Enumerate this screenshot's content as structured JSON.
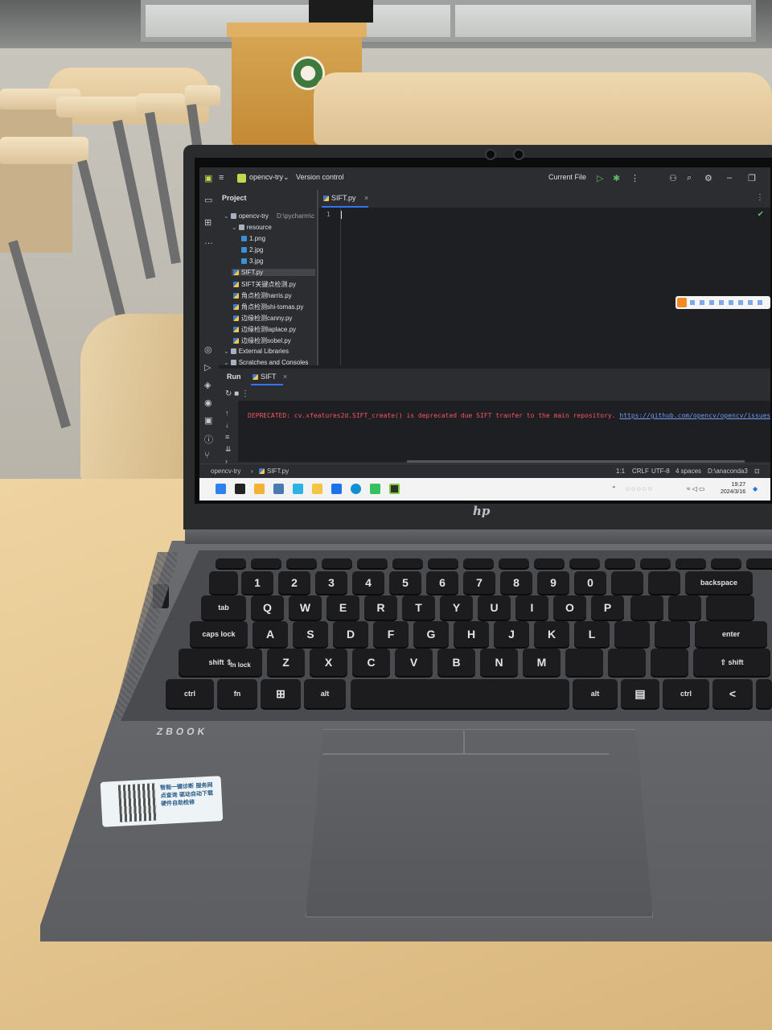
{
  "ide": {
    "project_name": "opencv-try",
    "version_control": "Version control",
    "run_config": "Current File",
    "project_panel_title": "Project",
    "root_path": "D:\\pycharm\\c",
    "tree": [
      {
        "label": "opencv-try",
        "kind": "dir",
        "indent": 0
      },
      {
        "label": "resource",
        "kind": "dir",
        "indent": 1
      },
      {
        "label": "1.png",
        "kind": "img",
        "indent": 2
      },
      {
        "label": "2.jpg",
        "kind": "img",
        "indent": 2
      },
      {
        "label": "3.jpg",
        "kind": "img",
        "indent": 2
      },
      {
        "label": "SIFT.py",
        "kind": "py",
        "indent": 1,
        "selected": true
      },
      {
        "label": "SIFT关键点检测.py",
        "kind": "py",
        "indent": 1
      },
      {
        "label": "角点检测harris.py",
        "kind": "py",
        "indent": 1
      },
      {
        "label": "角点检测shi-tomas.py",
        "kind": "py",
        "indent": 1
      },
      {
        "label": "边缘检测canny.py",
        "kind": "py",
        "indent": 1
      },
      {
        "label": "边缘检测laplace.py",
        "kind": "py",
        "indent": 1
      },
      {
        "label": "边缘检测sobel.py",
        "kind": "py",
        "indent": 1
      },
      {
        "label": "External Libraries",
        "kind": "dir",
        "indent": 0
      },
      {
        "label": "Scratches and Consoles",
        "kind": "dir",
        "indent": 0
      }
    ],
    "editor_tab": "SIFT.py",
    "line_number": "1",
    "run_title": "Run",
    "run_tab": "SIFT",
    "console_error": "DEPRECATED: cv.xfeatures2d.SIFT_create() is deprecated due SIFT tranfer to the main repository.",
    "console_link": "https://github.com/opencv/opencv/issues/16736",
    "status": {
      "breadcrumb_project": "opencv-try",
      "breadcrumb_file": "SIFT.py",
      "position": "1:1",
      "line_sep": "CRLF",
      "encoding": "UTF-8",
      "indent": "4 spaces",
      "interpreter": "D:\\anaconda3"
    }
  },
  "taskbar": {
    "time": "19:27",
    "date": "2024/3/16"
  },
  "laptop": {
    "brand_logo": "hp",
    "model": "ZBOOK",
    "keys_row_num": [
      "1",
      "2",
      "3",
      "4",
      "5",
      "6",
      "7",
      "8",
      "9",
      "0"
    ],
    "keys_row_q": [
      "Q",
      "W",
      "E",
      "R",
      "T",
      "Y",
      "U",
      "I",
      "O",
      "P"
    ],
    "keys_row_a": [
      "A",
      "S",
      "D",
      "F",
      "G",
      "H",
      "J",
      "K",
      "L"
    ],
    "keys_row_z": [
      "Z",
      "X",
      "C",
      "V",
      "B",
      "N",
      "M"
    ],
    "key_tab": "tab",
    "key_caps": "caps lock",
    "key_shift": "shift ⇧",
    "key_fnlock": "fn lock",
    "key_ctrl": "ctrl",
    "key_fn": "fn",
    "key_alt": "alt",
    "key_alt_r": "alt",
    "key_ctrl_r": "ctrl",
    "key_backspace": "backspace",
    "key_enter": "enter",
    "key_shift_r": "⇧ shift"
  },
  "sticker": {
    "text": "智能一键诊断 服务网点查询 驱动自动下载 硬件自助检修"
  },
  "colors": {
    "ide_bg": "#1e1f22",
    "ide_panel": "#2b2d30",
    "error_red": "#f75464",
    "link_blue": "#6f9cf2",
    "accent": "#3574f0"
  }
}
